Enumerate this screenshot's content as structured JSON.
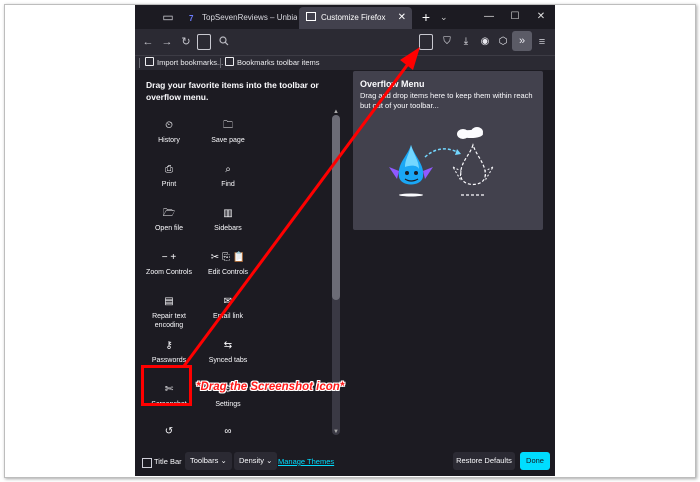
{
  "tabs": [
    {
      "label": "TopSevenReviews – Unbiased",
      "favicon": "7"
    },
    {
      "label": "Customize Firefox",
      "active": true
    }
  ],
  "window_controls": {
    "minimize": "—",
    "maximize": "☐",
    "close": "✕"
  },
  "bookmarks": [
    {
      "label": "Import bookmarks..."
    },
    {
      "label": "Bookmarks toolbar items"
    }
  ],
  "palette": {
    "title": "Drag your favorite items into the toolbar or overflow menu.",
    "items": [
      {
        "label": "History",
        "icon": "clock-icon",
        "glyph": "⏲"
      },
      {
        "label": "Save page",
        "icon": "save-page-icon",
        "glyph": "🗀"
      },
      {
        "label": "Print",
        "icon": "printer-icon",
        "glyph": "⎙"
      },
      {
        "label": "Find",
        "icon": "search-icon",
        "glyph": "⌕"
      },
      {
        "label": "Open file",
        "icon": "open-file-icon",
        "glyph": "🗁"
      },
      {
        "label": "Sidebars",
        "icon": "sidebar-icon",
        "glyph": "▥"
      },
      {
        "label": "Zoom Controls",
        "icon": "zoom-icon",
        "glyph": "− +"
      },
      {
        "label": "Edit Controls",
        "icon": "edit-icon",
        "glyph": "✂ ⎘ 📋"
      },
      {
        "label": "Repair text encoding",
        "icon": "text-encoding-icon",
        "glyph": "▤"
      },
      {
        "label": "Email link",
        "icon": "email-icon",
        "glyph": "✉"
      },
      {
        "label": "Passwords",
        "icon": "key-icon",
        "glyph": "⚷"
      },
      {
        "label": "Synced tabs",
        "icon": "synced-tabs-icon",
        "glyph": "⇆"
      },
      {
        "label": "Screenshot",
        "icon": "screenshot-icon",
        "glyph": "✄"
      },
      {
        "label": "Settings",
        "icon": "settings-icon",
        "glyph": "⚙"
      },
      {
        "label": "",
        "icon": "history-icon",
        "glyph": "↺"
      },
      {
        "label": "",
        "icon": "infinity-icon",
        "glyph": "∞"
      }
    ]
  },
  "overflow_panel": {
    "title": "Overflow Menu",
    "description": "Drag and drop items here to keep them within reach but out of your toolbar..."
  },
  "footer": {
    "title_bar_label": "Title Bar",
    "toolbars_label": "Toolbars",
    "density_label": "Density",
    "manage_themes_label": "Manage Themes",
    "restore_label": "Restore Defaults",
    "done_label": "Done"
  },
  "annotation": {
    "text": "*Drag the Screenshot icon*",
    "color": "#ff0000"
  },
  "colors": {
    "accent": "#00ddff",
    "window_bg": "#1c1b22",
    "panel_bg": "#42414d"
  }
}
